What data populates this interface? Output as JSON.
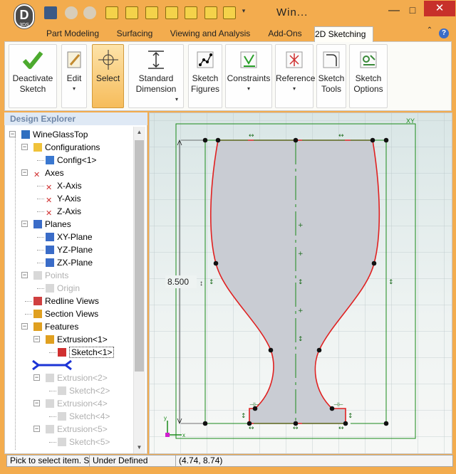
{
  "app": {
    "title": "Win...",
    "logo_letter": "D",
    "logo_sub": "3DS"
  },
  "window_controls": {
    "minimize": "—",
    "maximize": "□",
    "close": "✕"
  },
  "tabs": [
    "Part Modeling",
    "Surfacing",
    "Viewing and Analysis",
    "Add-Ons",
    "2D Sketching"
  ],
  "active_tab": "2D Sketching",
  "help": "?",
  "ribbon": {
    "deactivate": "Deactivate Sketch",
    "edit": "Edit",
    "select": "Select",
    "standard_dimension": "Standard Dimension",
    "sketch_figures": "Sketch Figures",
    "constraints": "Constraints",
    "reference": "Reference",
    "sketch_tools": "Sketch Tools",
    "sketch_options": "Sketch Options"
  },
  "explorer": {
    "title": "Design Explorer",
    "tree": [
      {
        "label": "WineGlassTop",
        "icon": "part-icon",
        "disabled": false
      },
      {
        "label": "Configurations",
        "icon": "configurations-icon",
        "disabled": false
      },
      {
        "label": "Config<1>",
        "icon": "config-icon",
        "disabled": false
      },
      {
        "label": "Axes",
        "icon": "axes-icon",
        "disabled": false
      },
      {
        "label": "X-Axis",
        "icon": "axis-icon",
        "disabled": false
      },
      {
        "label": "Y-Axis",
        "icon": "axis-icon",
        "disabled": false
      },
      {
        "label": "Z-Axis",
        "icon": "axis-icon",
        "disabled": false
      },
      {
        "label": "Planes",
        "icon": "planes-icon",
        "disabled": false
      },
      {
        "label": "XY-Plane",
        "icon": "plane-icon",
        "disabled": false
      },
      {
        "label": "YZ-Plane",
        "icon": "plane-icon",
        "disabled": false
      },
      {
        "label": "ZX-Plane",
        "icon": "plane-icon",
        "disabled": false
      },
      {
        "label": "Points",
        "icon": "points-icon",
        "disabled": true
      },
      {
        "label": "Origin",
        "icon": "origin-icon",
        "disabled": true
      },
      {
        "label": "Redline Views",
        "icon": "redline-icon",
        "disabled": false
      },
      {
        "label": "Section Views",
        "icon": "section-icon",
        "disabled": false
      },
      {
        "label": "Features",
        "icon": "features-icon",
        "disabled": false
      },
      {
        "label": "Extrusion<1>",
        "icon": "extrusion-icon",
        "disabled": false
      },
      {
        "label": "Sketch<1>",
        "icon": "sketch-icon",
        "disabled": false
      },
      {
        "label": "",
        "icon": "rollback-bar-icon",
        "disabled": false
      },
      {
        "label": "Extrusion<2>",
        "icon": "extrusion-icon",
        "disabled": true
      },
      {
        "label": "Sketch<2>",
        "icon": "sketch-icon",
        "disabled": true
      },
      {
        "label": "Extrusion<4>",
        "icon": "extrusion-icon",
        "disabled": true
      },
      {
        "label": "Sketch<4>",
        "icon": "sketch-icon",
        "disabled": true
      },
      {
        "label": "Extrusion<5>",
        "icon": "extrusion-icon",
        "disabled": true
      },
      {
        "label": "Sketch<5>",
        "icon": "sketch-icon",
        "disabled": true
      }
    ]
  },
  "canvas": {
    "dimension_value": "8.500",
    "plane_label": "XY"
  },
  "status": {
    "message": "Pick to select item. Sh",
    "state": "Under Defined",
    "coords": "(4.74, 8.74)"
  },
  "colors": {
    "accent": "#f3ac4e",
    "profile": "#e02020",
    "construction": "#1a8a1a",
    "fill": "#c9ccd3"
  }
}
